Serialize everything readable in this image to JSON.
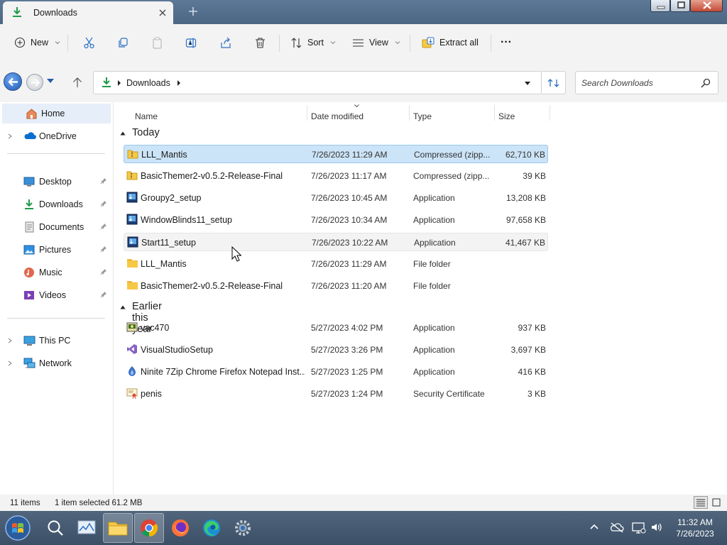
{
  "window": {
    "tab_title": "Downloads",
    "controls": {
      "minimize": "minimize",
      "maximize": "maximize",
      "close": "close"
    }
  },
  "toolbar": {
    "new_label": "New",
    "sort_label": "Sort",
    "view_label": "View",
    "extract_label": "Extract all",
    "more_label": "···"
  },
  "address": {
    "path": "Downloads",
    "search_placeholder": "Search Downloads"
  },
  "nav": {
    "home": "Home",
    "onedrive": "OneDrive",
    "quick": [
      {
        "label": "Desktop",
        "icon": "desktop-icon"
      },
      {
        "label": "Downloads",
        "icon": "downloads-icon"
      },
      {
        "label": "Documents",
        "icon": "documents-icon"
      },
      {
        "label": "Pictures",
        "icon": "pictures-icon"
      },
      {
        "label": "Music",
        "icon": "music-icon"
      },
      {
        "label": "Videos",
        "icon": "videos-icon"
      }
    ],
    "thispc": "This PC",
    "network": "Network"
  },
  "columns": {
    "name": "Name",
    "date": "Date modified",
    "type": "Type",
    "size": "Size"
  },
  "groups": [
    {
      "title": "Today",
      "files": [
        {
          "name": "LLL_Mantis",
          "date": "7/26/2023 11:29 AM",
          "type": "Compressed (zipp...",
          "size": "62,710 KB",
          "icon": "zip-icon",
          "state": "selected"
        },
        {
          "name": "BasicThemer2-v0.5.2-Release-Final",
          "date": "7/26/2023 11:17 AM",
          "type": "Compressed (zipp...",
          "size": "39 KB",
          "icon": "zip-icon",
          "state": ""
        },
        {
          "name": "Groupy2_setup",
          "date": "7/26/2023 10:45 AM",
          "type": "Application",
          "size": "13,208 KB",
          "icon": "installer-icon",
          "state": ""
        },
        {
          "name": "WindowBlinds11_setup",
          "date": "7/26/2023 10:34 AM",
          "type": "Application",
          "size": "97,658 KB",
          "icon": "installer-icon",
          "state": ""
        },
        {
          "name": "Start11_setup",
          "date": "7/26/2023 10:22 AM",
          "type": "Application",
          "size": "41,467 KB",
          "icon": "installer-icon",
          "state": "hover"
        },
        {
          "name": "LLL_Mantis",
          "date": "7/26/2023 11:29 AM",
          "type": "File folder",
          "size": "",
          "icon": "folder-icon",
          "state": ""
        },
        {
          "name": "BasicThemer2-v0.5.2-Release-Final",
          "date": "7/26/2023 11:20 AM",
          "type": "File folder",
          "size": "",
          "icon": "folder-icon",
          "state": ""
        }
      ]
    },
    {
      "title": "Earlier this year",
      "files": [
        {
          "name": "vac470",
          "date": "5/27/2023 4:02 PM",
          "type": "Application",
          "size": "937 KB",
          "icon": "app-icon",
          "state": ""
        },
        {
          "name": "VisualStudioSetup",
          "date": "5/27/2023 3:26 PM",
          "type": "Application",
          "size": "3,697 KB",
          "icon": "visual-studio-icon",
          "state": ""
        },
        {
          "name": "Ninite 7Zip Chrome Firefox Notepad Inst...",
          "date": "5/27/2023 1:25 PM",
          "type": "Application",
          "size": "416 KB",
          "icon": "ninite-icon",
          "state": ""
        },
        {
          "name": "penis",
          "date": "5/27/2023 1:24 PM",
          "type": "Security Certificate",
          "size": "3 KB",
          "icon": "certificate-icon",
          "state": ""
        }
      ]
    }
  ],
  "status": {
    "count": "11 items",
    "selection": "1 item selected  61.2 MB"
  },
  "taskbar": {
    "apps": [
      "start-orb-icon",
      "search-icon",
      "task-manager-icon",
      "file-explorer-icon",
      "chrome-icon",
      "firefox-icon",
      "edge-icon",
      "settings-icon"
    ],
    "clock_time": "11:32 AM",
    "clock_date": "7/26/2023"
  },
  "colors": {
    "accent": "#0067c0",
    "selection": "#cce4f7",
    "taskbar": "#3b4f66",
    "titlebar": "#4c6784",
    "folder": "#f7c846"
  }
}
